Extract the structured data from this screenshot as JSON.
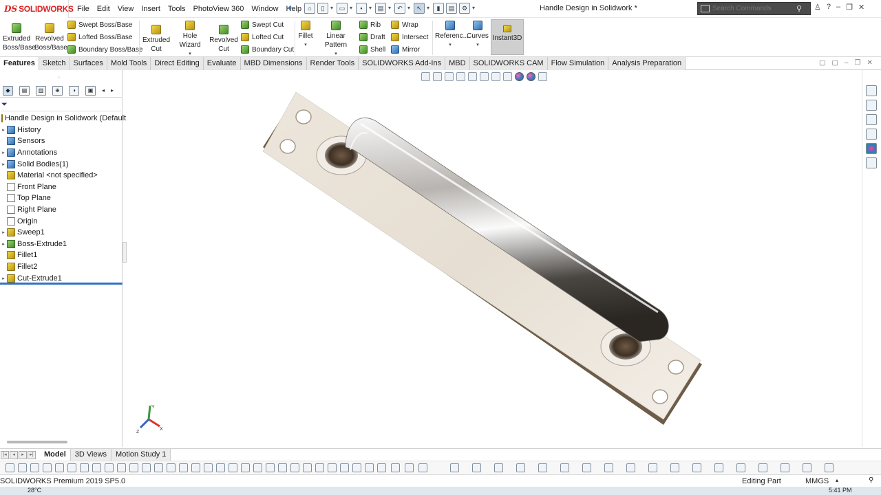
{
  "app": {
    "logo_mark": "DS",
    "logo_name": "SOLIDWORKS",
    "doc_title": "Handle Design in Solidwork *"
  },
  "menu": [
    "File",
    "Edit",
    "View",
    "Insert",
    "Tools",
    "PhotoView 360",
    "Window",
    "Help"
  ],
  "search": {
    "placeholder": "Search Commands"
  },
  "window_controls": {
    "user": "person-icon",
    "help": "?",
    "minimize": "–",
    "restore": "❐",
    "close": "✕"
  },
  "ribbon": {
    "extruded_boss": "Extruded Boss/Base",
    "revolved_boss": "Revolved Boss/Base",
    "swept_boss": "Swept Boss/Base",
    "lofted_boss": "Lofted Boss/Base",
    "boundary_boss": "Boundary Boss/Base",
    "extruded_cut": "Extruded Cut",
    "hole_wizard": "Hole Wizard",
    "revolved_cut": "Revolved Cut",
    "swept_cut": "Swept Cut",
    "lofted_cut": "Lofted Cut",
    "boundary_cut": "Boundary Cut",
    "fillet": "Fillet",
    "linear_pattern": "Linear Pattern",
    "rib": "Rib",
    "draft": "Draft",
    "shell": "Shell",
    "wrap": "Wrap",
    "intersect": "Intersect",
    "mirror": "Mirror",
    "reference": "Referenc...",
    "curves": "Curves",
    "instant3d": "Instant3D"
  },
  "tabs": [
    "Features",
    "Sketch",
    "Surfaces",
    "Mold Tools",
    "Direct Editing",
    "Evaluate",
    "MBD Dimensions",
    "Render Tools",
    "SOLIDWORKS Add-Ins",
    "MBD",
    "SOLIDWORKS CAM",
    "Flow Simulation",
    "Analysis Preparation"
  ],
  "tree": {
    "root": "Handle Design in Solidwork  (Default",
    "items": [
      {
        "label": "History",
        "expandable": true,
        "icon": "history-icon"
      },
      {
        "label": "Sensors",
        "expandable": false,
        "icon": "sensor-icon"
      },
      {
        "label": "Annotations",
        "expandable": true,
        "icon": "annotation-icon"
      },
      {
        "label": "Solid Bodies(1)",
        "expandable": true,
        "icon": "solid-bodies-icon"
      },
      {
        "label": "Material <not specified>",
        "expandable": false,
        "icon": "material-icon"
      },
      {
        "label": "Front Plane",
        "expandable": false,
        "icon": "plane-icon"
      },
      {
        "label": "Top Plane",
        "expandable": false,
        "icon": "plane-icon"
      },
      {
        "label": "Right Plane",
        "expandable": false,
        "icon": "plane-icon"
      },
      {
        "label": "Origin",
        "expandable": false,
        "icon": "origin-icon"
      },
      {
        "label": "Sweep1",
        "expandable": true,
        "icon": "sweep-icon"
      },
      {
        "label": "Boss-Extrude1",
        "expandable": true,
        "icon": "extrude-icon"
      },
      {
        "label": "Fillet1",
        "expandable": false,
        "icon": "fillet-icon"
      },
      {
        "label": "Fillet2",
        "expandable": false,
        "icon": "fillet-icon"
      },
      {
        "label": "Cut-Extrude1",
        "expandable": true,
        "icon": "cut-extrude-icon"
      }
    ]
  },
  "bottom_tabs": [
    "Model",
    "3D Views",
    "Motion Study 1"
  ],
  "status": {
    "product": "SOLIDWORKS Premium 2019 SP5.0",
    "mode": "Editing Part",
    "units": "MMGS"
  },
  "taskbar": {
    "temp": "28°C",
    "time": "5:41 PM"
  },
  "colors": {
    "accent": "#2f73c0",
    "logo": "#d22222",
    "instant3d_bg": "#cfcfcf"
  }
}
